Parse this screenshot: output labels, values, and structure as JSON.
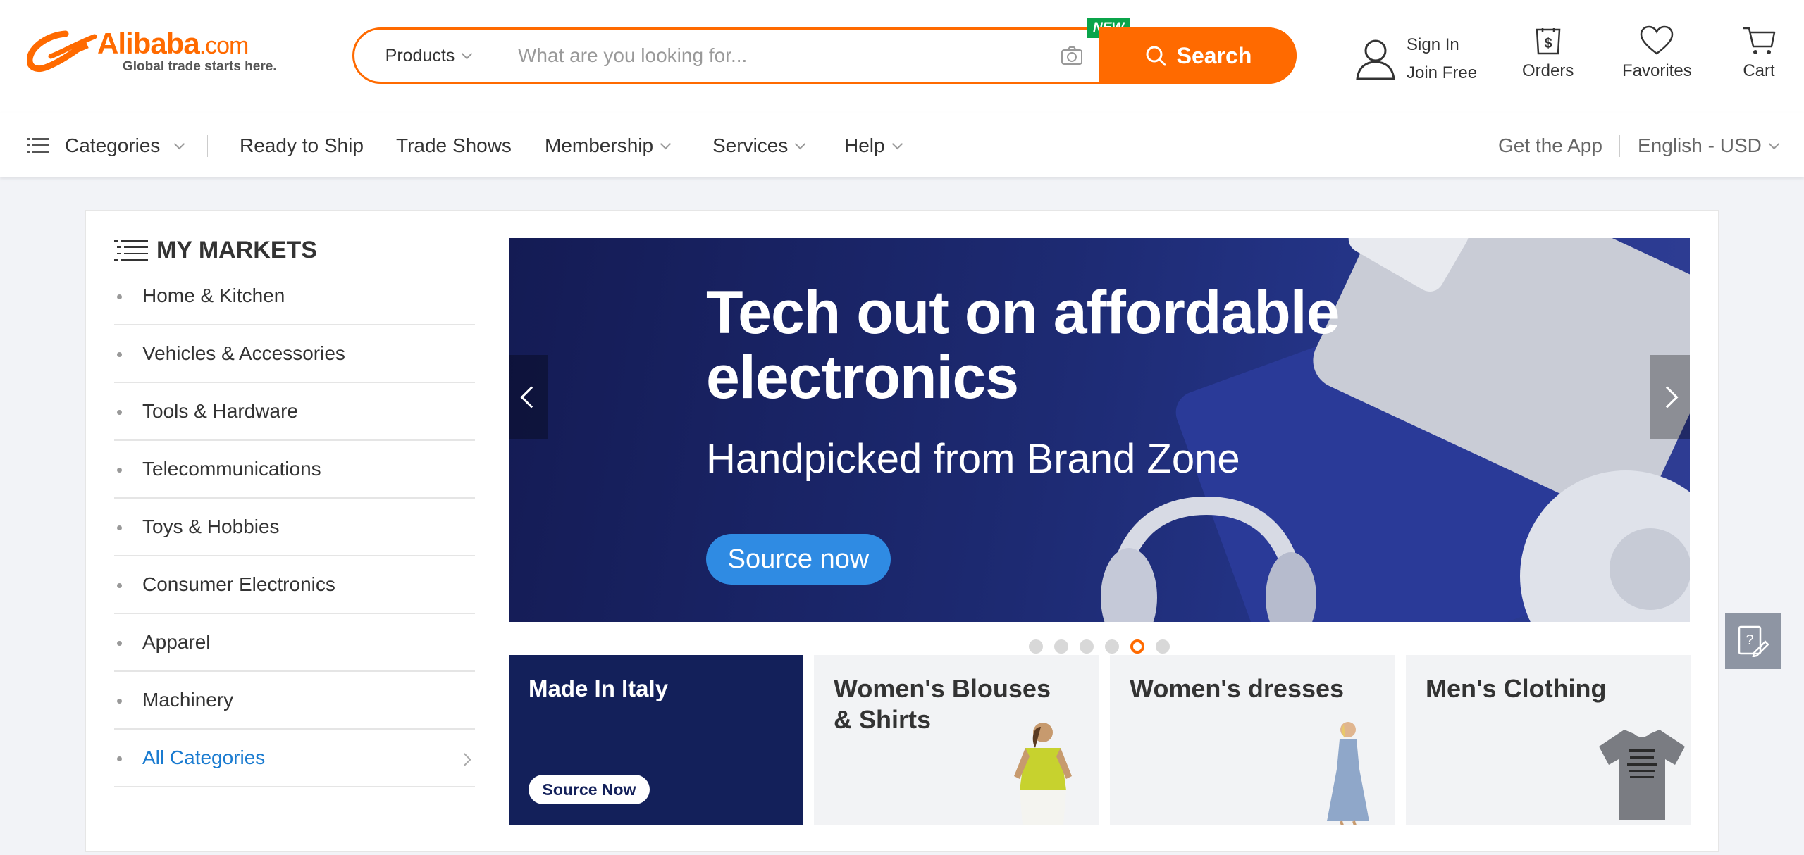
{
  "header": {
    "logo_word": "Alibaba",
    "logo_dotcom": ".com",
    "logo_tagline": "Global trade starts here.",
    "search": {
      "category": "Products",
      "placeholder": "What are you looking for...",
      "new_badge": "NEW",
      "button_label": "Search"
    },
    "account": {
      "sign_in": "Sign In",
      "join": "Join Free"
    },
    "orders": "Orders",
    "favorites": "Favorites",
    "cart": "Cart"
  },
  "nav": {
    "categories": "Categories",
    "items": [
      "Ready to Ship",
      "Trade Shows",
      "Membership",
      "Services",
      "Help"
    ],
    "get_app": "Get the App",
    "language_currency": "English - USD"
  },
  "markets": {
    "title": "MY MARKETS",
    "items": [
      "Home & Kitchen",
      "Vehicles & Accessories",
      "Tools & Hardware",
      "Telecommunications",
      "Toys & Hobbies",
      "Consumer Electronics",
      "Apparel",
      "Machinery",
      "All Categories"
    ]
  },
  "banner": {
    "title_line1": "Tech out on affordable",
    "title_line2": "electronics",
    "subtitle": "Handpicked from Brand Zone",
    "button": "Source now",
    "slide_count": 6,
    "active_slide": 5
  },
  "tiles": [
    {
      "title": "Made In Italy",
      "button": "Source Now"
    },
    {
      "title_line1": "Women's Blouses",
      "title_line2": "& Shirts"
    },
    {
      "title": "Women's dresses"
    },
    {
      "title": "Men's Clothing"
    }
  ],
  "colors": {
    "brand_orange": "#ff6a00",
    "banner_navy": "#1d2a72",
    "link_blue": "#1a7bd0",
    "badge_green": "#0aa44a"
  }
}
